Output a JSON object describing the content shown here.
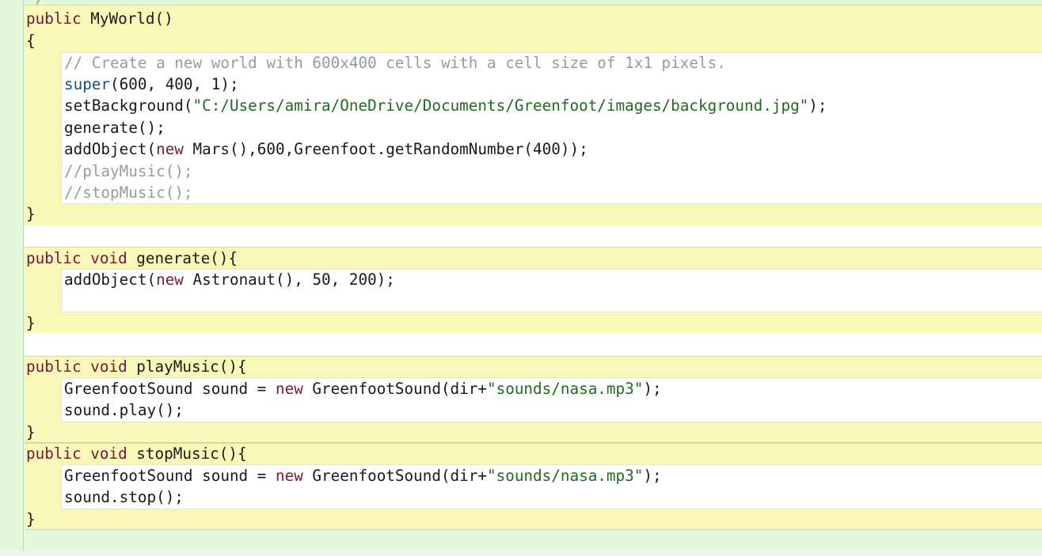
{
  "editor": {
    "top_fragment": "*/",
    "constructor": {
      "header": {
        "kw": "public",
        "name": " MyWorld()"
      },
      "open": "{",
      "comment": "// Create a new world with 600x400 cells with a cell size of 1x1 pixels.",
      "super_kw": "super",
      "super_args": "(600, 400, 1);",
      "set_bg_call": "setBackground(",
      "set_bg_path": "\"C:/Users/amira/OneDrive/Documents/Greenfoot/images/background.jpg\"",
      "set_bg_end": ");",
      "generate_call": "generate();",
      "add_mars_start": "addObject(",
      "add_mars_new": "new",
      "add_mars_rest": " Mars(),600,Greenfoot.getRandomNumber(400));",
      "comment_play": "//playMusic();",
      "comment_stop": "//stopMusic();",
      "close": "}"
    },
    "generate": {
      "kw_public": "public",
      "kw_void": "void",
      "name": " generate(){",
      "add_start": "addObject(",
      "add_new": "new",
      "add_rest": " Astronaut(), 50, 200);",
      "close": "}"
    },
    "play_music": {
      "kw_public": "public",
      "kw_void": "void",
      "name": " playMusic(){",
      "decl_start": "GreenfootSound sound = ",
      "decl_new": "new",
      "decl_mid": " GreenfootSound(dir+",
      "decl_str": "\"sounds/nasa.mp3\"",
      "decl_end": ");",
      "call": "sound.play();",
      "close": "}"
    },
    "stop_music": {
      "kw_public": "public",
      "kw_void": "void",
      "name": " stopMusic(){",
      "decl_start": "GreenfootSound sound = ",
      "decl_new": "new",
      "decl_mid": " GreenfootSound(dir+",
      "decl_str": "\"sounds/nasa.mp3\"",
      "decl_end": ");",
      "call": "sound.stop();",
      "close": "}"
    }
  }
}
